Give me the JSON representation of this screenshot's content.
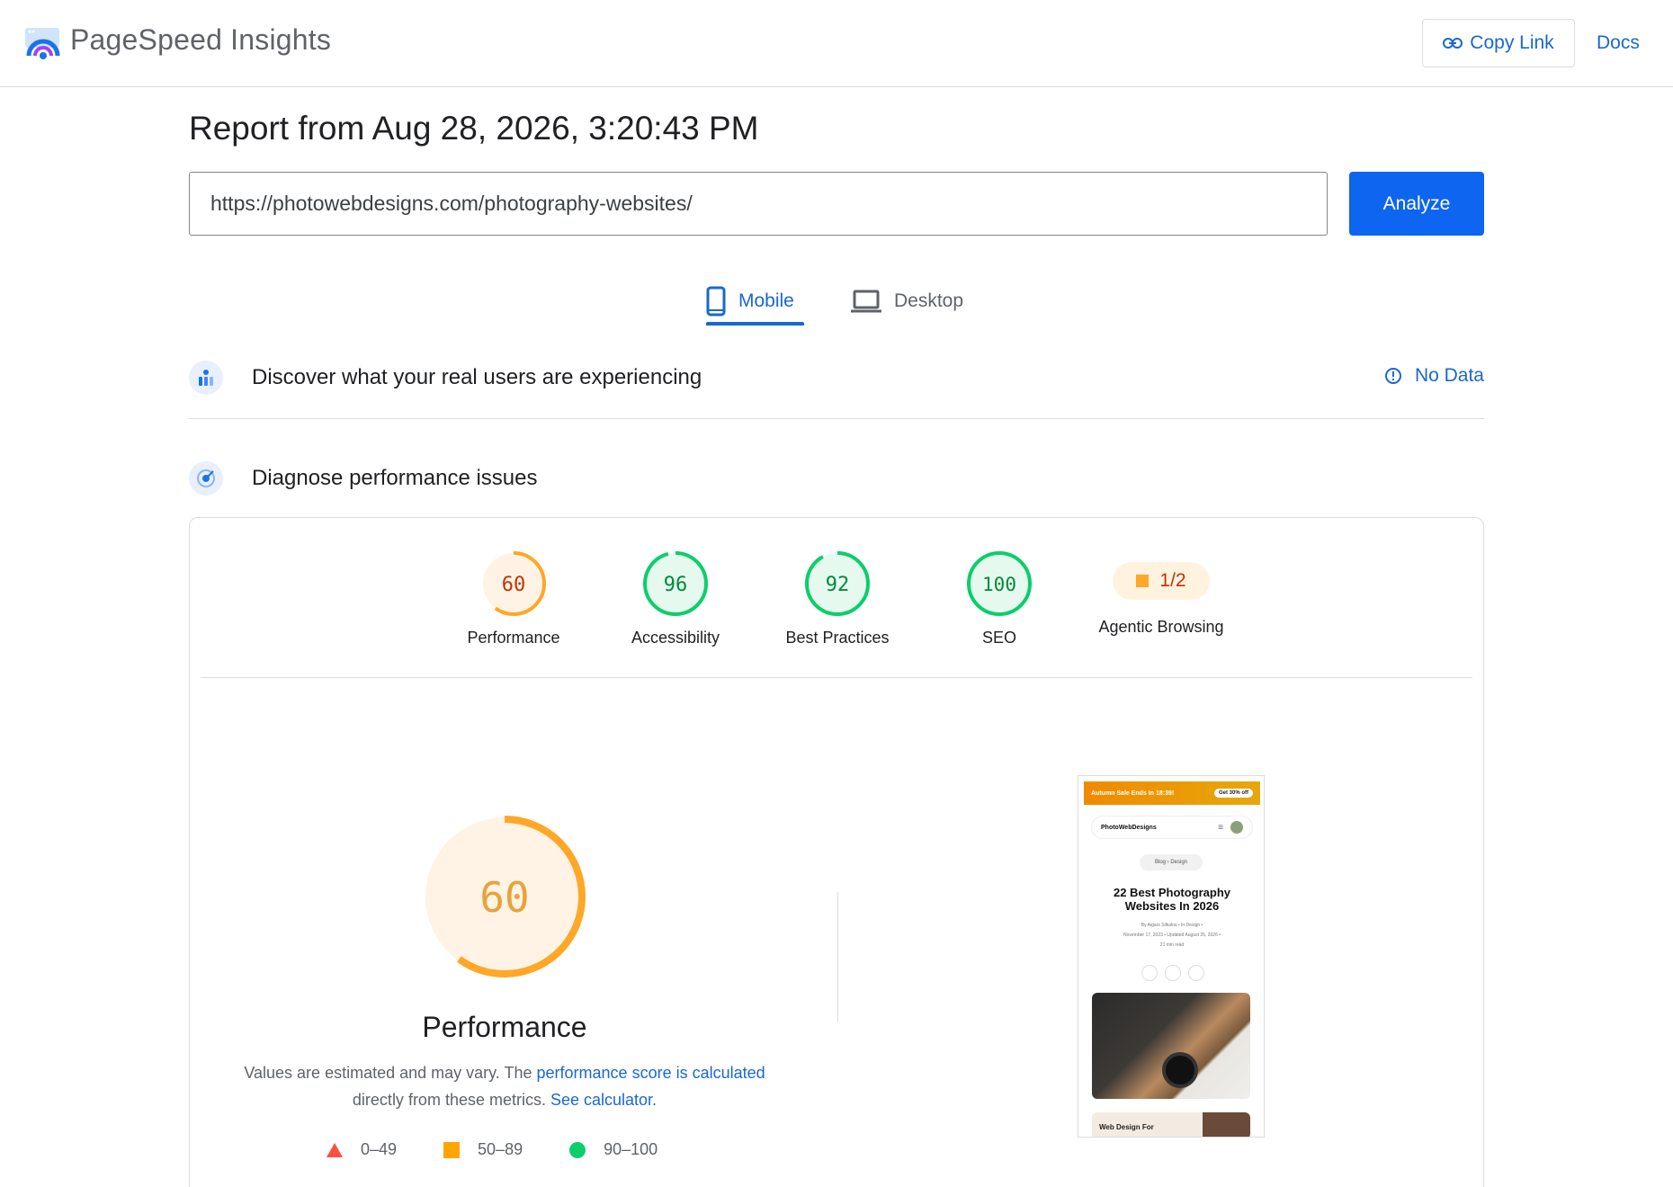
{
  "header": {
    "app_title": "PageSpeed Insights",
    "copy_link_label": "Copy Link",
    "docs_label": "Docs"
  },
  "report": {
    "title": "Report from Aug 28, 2026, 3:20:43 PM",
    "url_value": "https://photowebdesigns.com/photography-websites/",
    "analyze_label": "Analyze"
  },
  "tabs": [
    {
      "label": "Mobile",
      "selected": true
    },
    {
      "label": "Desktop",
      "selected": false
    }
  ],
  "field_data": {
    "label": "Discover what your real users are experiencing",
    "status": "No Data"
  },
  "diagnose": {
    "label": "Diagnose performance issues"
  },
  "categories": [
    {
      "name": "Performance",
      "score": "60",
      "color": "#ffa726"
    },
    {
      "name": "Accessibility",
      "score": "96",
      "color": "#0cce6b"
    },
    {
      "name": "Best Practices",
      "score": "92",
      "color": "#0cce6b"
    },
    {
      "name": "SEO",
      "score": "100",
      "color": "#0cce6b"
    },
    {
      "name": "Agentic Browsing",
      "score": "1/2",
      "color": "#ffa726"
    }
  ],
  "performance": {
    "score": "60",
    "label": "Performance",
    "note_prefix": "Values are estimated and may vary. The ",
    "note_link1": "performance score is calculated",
    "note_middle": " directly from these metrics. ",
    "note_link2": "See calculator.",
    "legend": [
      {
        "range": "0–49",
        "color": "#ff4e42",
        "shape": "triangle"
      },
      {
        "range": "50–89",
        "color": "#ffa400",
        "shape": "square"
      },
      {
        "range": "90–100",
        "color": "#0cce6b",
        "shape": "circle"
      }
    ]
  },
  "screenshot": {
    "banner_text": "Autumn Sale Ends In 18:39!",
    "banner_cta": "Get 30% off",
    "site_name": "PhotoWebDesigns",
    "breadcrumb": "Blog  ›  Design",
    "headline": "22 Best Photography Websites In 2026",
    "meta_line1": "By Aigars Silkalns  •  In Design  •",
    "meta_line2": "November 17, 2023  •  Updated August 25, 2026  •",
    "meta_line3": "21 min read",
    "next_card": "Web Design For"
  },
  "colors": {
    "accent": "#1967d2",
    "analyze_bg": "#0d65f0",
    "average_orange": "#ffa726",
    "pass_green": "#0cce6b"
  }
}
